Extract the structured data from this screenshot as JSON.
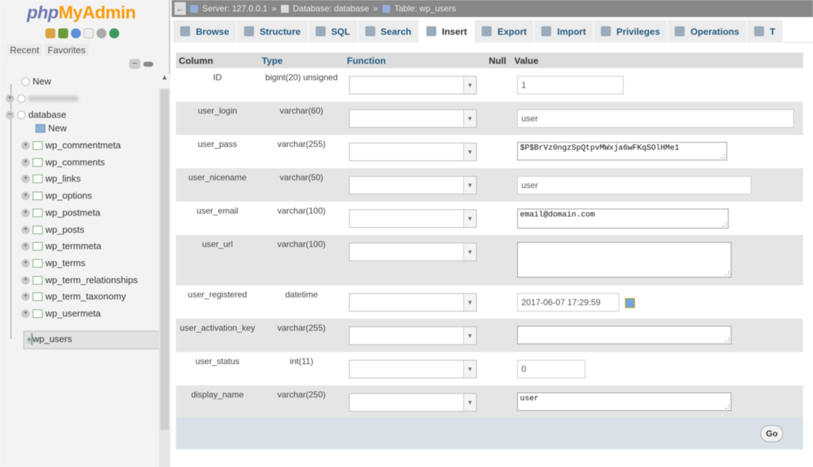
{
  "sidebar": {
    "logo_php": "php",
    "logo_my": "MyAdmin",
    "tabs": [
      "Recent",
      "Favorites"
    ],
    "collapse": "−",
    "tree": {
      "new": "New",
      "database": "database",
      "db_new": "New",
      "tables": [
        "wp_commentmeta",
        "wp_comments",
        "wp_links",
        "wp_options",
        "wp_postmeta",
        "wp_posts",
        "wp_termmeta",
        "wp_terms",
        "wp_term_relationships",
        "wp_term_taxonomy",
        "wp_usermeta",
        "wp_users"
      ],
      "selected": "wp_users"
    }
  },
  "breadcrumb": {
    "server": "Server: 127.0.0.1",
    "database": "Database: database",
    "table": "Table: wp_users"
  },
  "tabs": [
    "Browse",
    "Structure",
    "SQL",
    "Search",
    "Insert",
    "Export",
    "Import",
    "Privileges",
    "Operations",
    "T"
  ],
  "active_tab": "Insert",
  "headers": {
    "column": "Column",
    "type": "Type",
    "function": "Function",
    "null": "Null",
    "value": "Value"
  },
  "rows": [
    {
      "column": "ID",
      "type": "bigint(20) unsigned",
      "value": "1"
    },
    {
      "column": "user_login",
      "type": "varchar(60)",
      "value": "user"
    },
    {
      "column": "user_pass",
      "type": "varchar(255)",
      "value": "$P$BrVz0ngzSpQtpvMWxja6wFKqSOlHMe1"
    },
    {
      "column": "user_nicename",
      "type": "varchar(50)",
      "value": "user"
    },
    {
      "column": "user_email",
      "type": "varchar(100)",
      "value": "email@domain.com"
    },
    {
      "column": "user_url",
      "type": "varchar(100)",
      "value": ""
    },
    {
      "column": "user_registered",
      "type": "datetime",
      "value": "2017-06-07 17:29:59"
    },
    {
      "column": "user_activation_key",
      "type": "varchar(255)",
      "value": ""
    },
    {
      "column": "user_status",
      "type": "int(11)",
      "value": "0"
    },
    {
      "column": "display_name",
      "type": "varchar(250)",
      "value": "user"
    }
  ],
  "go_label": "Go"
}
